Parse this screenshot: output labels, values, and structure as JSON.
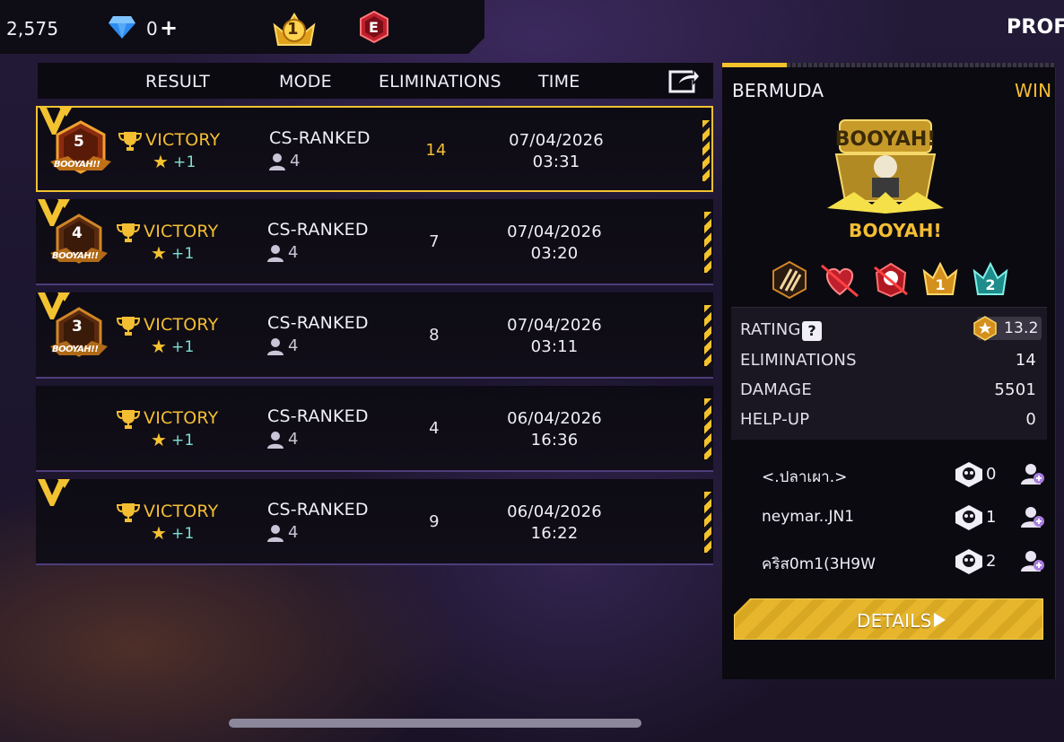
{
  "topbar": {
    "coins": "2,575",
    "diamonds": "0",
    "diamond_plus": "+",
    "rank_number": "1",
    "e_badge": "E",
    "profile_tab": "PROFI"
  },
  "header": {
    "result": "RESULT",
    "mode": "MODE",
    "eliminations": "ELIMINATIONS",
    "time": "TIME"
  },
  "matches": [
    {
      "medal": "5",
      "medal_text": "BOOYAH!!",
      "result": "VICTORY",
      "star": "★",
      "reward": "+1",
      "mode": "CS-RANKED",
      "players": "4",
      "eliminations": "14",
      "date": "07/04/2026",
      "time": "03:31"
    },
    {
      "medal": "4",
      "medal_text": "BOOYAH!!",
      "result": "VICTORY",
      "star": "★",
      "reward": "+1",
      "mode": "CS-RANKED",
      "players": "4",
      "eliminations": "7",
      "date": "07/04/2026",
      "time": "03:20"
    },
    {
      "medal": "3",
      "medal_text": "BOOYAH!!",
      "result": "VICTORY",
      "star": "★",
      "reward": "+1",
      "mode": "CS-RANKED",
      "players": "4",
      "eliminations": "8",
      "date": "07/04/2026",
      "time": "03:11"
    },
    {
      "medal": "",
      "medal_text": "",
      "result": "VICTORY",
      "star": "★",
      "reward": "+1",
      "mode": "CS-RANKED",
      "players": "4",
      "eliminations": "4",
      "date": "06/04/2026",
      "time": "16:36"
    },
    {
      "medal": "",
      "medal_text": "",
      "result": "VICTORY",
      "star": "★",
      "reward": "+1",
      "mode": "CS-RANKED",
      "players": "4",
      "eliminations": "9",
      "date": "06/04/2026",
      "time": "16:22"
    }
  ],
  "panel": {
    "map": "BERMUDA",
    "outcome": "WIN",
    "booyah": "BOOYAH!",
    "booyah_art_text": "BOOYAH!",
    "badge_numbers": [
      "1",
      "2"
    ],
    "stats": {
      "rating_label": "RATING",
      "help": "?",
      "rating_value": "13.2",
      "eliminations_label": "ELIMINATIONS",
      "eliminations_value": "14",
      "damage_label": "DAMAGE",
      "damage_value": "5501",
      "helpup_label": "HELP-UP",
      "helpup_value": "0"
    },
    "players": [
      {
        "name": "<.ปลาเผา.>",
        "kills": "0"
      },
      {
        "name": "neymar..JN1",
        "kills": "1"
      },
      {
        "name": "คริส0m1(3H9W",
        "kills": "2"
      }
    ],
    "details_button": "DETAILS"
  },
  "colors": {
    "accent_gold": "#f4be33",
    "panel_bg": "#0c0a11",
    "reward_teal": "#7fe0d4"
  },
  "icons": [
    "diamond-icon",
    "rank-crown-icon",
    "share-icon",
    "trophy-icon",
    "star-icon",
    "player-icon",
    "skull-icon",
    "add-friend-icon",
    "play-arrow-icon"
  ]
}
